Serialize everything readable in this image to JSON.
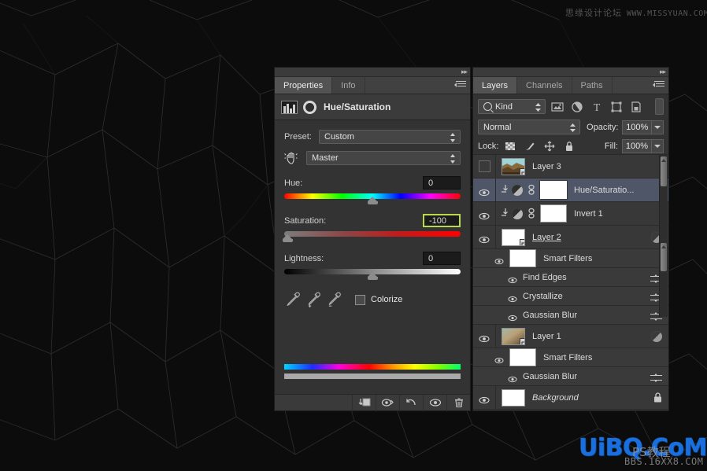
{
  "app": {
    "watermark_top_cn": "思缘设计论坛",
    "watermark_top_url": "WWW.MISSYUAN.COM",
    "watermark_bottom": "UiBQ.CoM",
    "watermark_bottom_sub1": "PS教程",
    "watermark_bottom_sub2": "BBS.16XX8.COM"
  },
  "properties_panel": {
    "tabs": [
      {
        "label": "Properties",
        "active": true
      },
      {
        "label": "Info",
        "active": false
      }
    ],
    "title": "Hue/Saturation",
    "preset_label": "Preset:",
    "preset_value": "Custom",
    "channel_value": "Master",
    "sliders": [
      {
        "label": "Hue:",
        "value": "0",
        "thumb_pct": 50,
        "highlighted": false,
        "track": "hue"
      },
      {
        "label": "Saturation:",
        "value": "-100",
        "thumb_pct": 2,
        "highlighted": true,
        "track": "sat"
      },
      {
        "label": "Lightness:",
        "value": "0",
        "thumb_pct": 50,
        "highlighted": false,
        "track": "light"
      }
    ],
    "colorize_label": "Colorize",
    "colorize_checked": false,
    "footer_buttons": [
      "clip-to-layer-icon",
      "view-previous-state-icon",
      "reset-icon",
      "toggle-visibility-icon",
      "delete-icon"
    ],
    "highlight_color": "#b9d84a"
  },
  "layers_panel": {
    "tabs": [
      {
        "label": "Layers",
        "active": true
      },
      {
        "label": "Channels",
        "active": false
      },
      {
        "label": "Paths",
        "active": false
      }
    ],
    "kind_filter": "Kind",
    "filter_icons": [
      "pixel-layer-icon",
      "adjustment-layer-icon",
      "type-layer-icon",
      "shape-layer-icon",
      "smart-object-icon"
    ],
    "blend_mode": "Normal",
    "opacity_label": "Opacity:",
    "opacity_value": "100%",
    "lock_label": "Lock:",
    "lock_icons": [
      "lock-transparent-pixels-icon",
      "lock-image-pixels-icon",
      "lock-position-icon",
      "lock-all-icon"
    ],
    "fill_label": "Fill:",
    "fill_value": "100%",
    "rows": [
      {
        "name": "Layer 3",
        "type": "layer",
        "visible": false,
        "selected": false,
        "thumb": "photo",
        "smart": true,
        "fx": false,
        "locked": false,
        "style": "normal"
      },
      {
        "name": "Hue/Saturatio...",
        "type": "adjustment",
        "visible": true,
        "selected": true,
        "thumb": "mask",
        "smart": false,
        "fx": false,
        "locked": false,
        "style": "normal"
      },
      {
        "name": "Invert 1",
        "type": "adjustment",
        "visible": true,
        "selected": false,
        "thumb": "mask",
        "smart": false,
        "fx": false,
        "locked": false,
        "style": "normal"
      },
      {
        "name": "Layer 2",
        "type": "layer",
        "visible": true,
        "selected": false,
        "thumb": "white",
        "smart": true,
        "fx": true,
        "locked": false,
        "style": "underline"
      },
      {
        "name": "Smart Filters",
        "type": "smartfilters",
        "visible": true
      },
      {
        "name": "Find Edges",
        "type": "filter",
        "visible": true
      },
      {
        "name": "Crystallize",
        "type": "filter",
        "visible": true
      },
      {
        "name": "Gaussian Blur",
        "type": "filter",
        "visible": true
      },
      {
        "name": "Layer 1",
        "type": "layer",
        "visible": true,
        "selected": false,
        "thumb": "blur",
        "smart": true,
        "fx": true,
        "locked": false,
        "style": "normal"
      },
      {
        "name": "Smart Filters",
        "type": "smartfilters",
        "visible": true
      },
      {
        "name": "Gaussian Blur",
        "type": "filter",
        "visible": true
      },
      {
        "name": "Background",
        "type": "layer",
        "visible": true,
        "selected": false,
        "thumb": "white",
        "smart": false,
        "fx": false,
        "locked": true,
        "style": "italic"
      }
    ],
    "selection_color": "#4f5667"
  }
}
